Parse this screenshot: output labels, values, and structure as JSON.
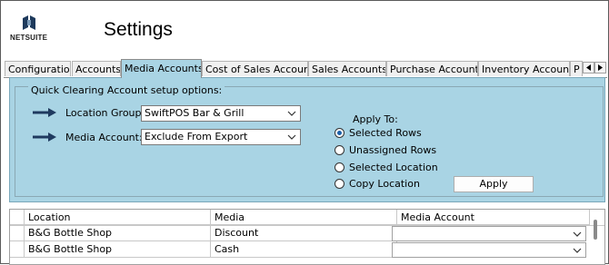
{
  "header": {
    "logo_text": "NETSUITE",
    "title": "Settings"
  },
  "tabs": [
    {
      "label": "Configuratio",
      "active": false
    },
    {
      "label": "Accounts",
      "active": false
    },
    {
      "label": "Media Accounts",
      "active": true
    },
    {
      "label": "Cost of Sales Account",
      "active": false
    },
    {
      "label": "Sales Accounts",
      "active": false
    },
    {
      "label": "Purchase Account",
      "active": false
    },
    {
      "label": "Inventory Accounts",
      "active": false
    },
    {
      "label": "P",
      "active": false
    }
  ],
  "panel": {
    "legend": "Quick Clearing Account setup options:",
    "location_group_label": "Location Group:",
    "location_group_value": "SwiftPOS Bar & Grill",
    "media_account_label": "Media Account:",
    "media_account_value": "Exclude From Export",
    "apply_to_label": "Apply To:",
    "radio_options": [
      {
        "label": "Selected Rows",
        "selected": true
      },
      {
        "label": "Unassigned Rows",
        "selected": false
      },
      {
        "label": "Selected Location",
        "selected": false
      },
      {
        "label": "Copy Location",
        "selected": false
      }
    ],
    "apply_button": "Apply"
  },
  "grid": {
    "columns": [
      "Location",
      "Media",
      "Media Account"
    ],
    "rows": [
      {
        "location": "B&G Bottle Shop",
        "media": "Discount",
        "media_account": ""
      },
      {
        "location": "B&G Bottle Shop",
        "media": "Cash",
        "media_account": ""
      }
    ]
  },
  "colors": {
    "panel_bg": "#a9d4e4",
    "radio_accent": "#1a5fa8",
    "arrow": "#1f3a5f"
  },
  "icons": {
    "logo": "netsuite-logo-icon",
    "arrows": "arrow-right-icon",
    "dropdown": "chevron-down-icon",
    "tab_scroll": [
      "triangle-left-icon",
      "triangle-right-icon"
    ]
  }
}
